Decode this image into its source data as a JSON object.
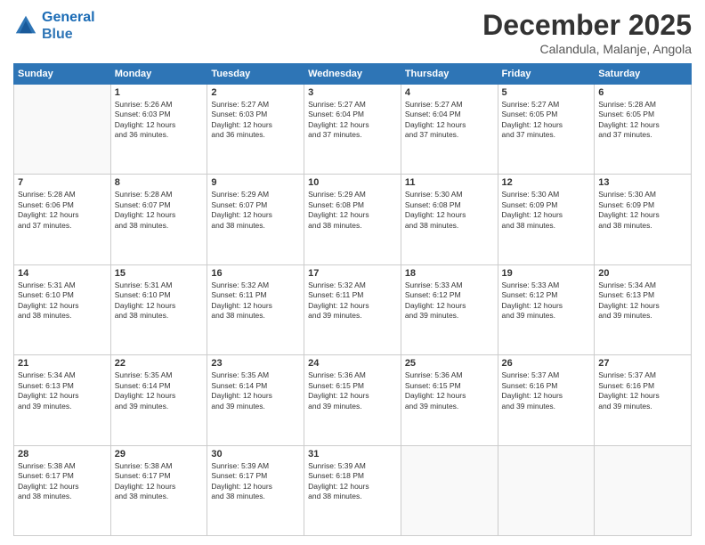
{
  "header": {
    "logo_line1": "General",
    "logo_line2": "Blue",
    "title": "December 2025",
    "subtitle": "Calandula, Malanje, Angola"
  },
  "calendar": {
    "days_of_week": [
      "Sunday",
      "Monday",
      "Tuesday",
      "Wednesday",
      "Thursday",
      "Friday",
      "Saturday"
    ],
    "weeks": [
      [
        {
          "day": "",
          "info": ""
        },
        {
          "day": "1",
          "info": "Sunrise: 5:26 AM\nSunset: 6:03 PM\nDaylight: 12 hours\nand 36 minutes."
        },
        {
          "day": "2",
          "info": "Sunrise: 5:27 AM\nSunset: 6:03 PM\nDaylight: 12 hours\nand 36 minutes."
        },
        {
          "day": "3",
          "info": "Sunrise: 5:27 AM\nSunset: 6:04 PM\nDaylight: 12 hours\nand 37 minutes."
        },
        {
          "day": "4",
          "info": "Sunrise: 5:27 AM\nSunset: 6:04 PM\nDaylight: 12 hours\nand 37 minutes."
        },
        {
          "day": "5",
          "info": "Sunrise: 5:27 AM\nSunset: 6:05 PM\nDaylight: 12 hours\nand 37 minutes."
        },
        {
          "day": "6",
          "info": "Sunrise: 5:28 AM\nSunset: 6:05 PM\nDaylight: 12 hours\nand 37 minutes."
        }
      ],
      [
        {
          "day": "7",
          "info": "Sunrise: 5:28 AM\nSunset: 6:06 PM\nDaylight: 12 hours\nand 37 minutes."
        },
        {
          "day": "8",
          "info": "Sunrise: 5:28 AM\nSunset: 6:07 PM\nDaylight: 12 hours\nand 38 minutes."
        },
        {
          "day": "9",
          "info": "Sunrise: 5:29 AM\nSunset: 6:07 PM\nDaylight: 12 hours\nand 38 minutes."
        },
        {
          "day": "10",
          "info": "Sunrise: 5:29 AM\nSunset: 6:08 PM\nDaylight: 12 hours\nand 38 minutes."
        },
        {
          "day": "11",
          "info": "Sunrise: 5:30 AM\nSunset: 6:08 PM\nDaylight: 12 hours\nand 38 minutes."
        },
        {
          "day": "12",
          "info": "Sunrise: 5:30 AM\nSunset: 6:09 PM\nDaylight: 12 hours\nand 38 minutes."
        },
        {
          "day": "13",
          "info": "Sunrise: 5:30 AM\nSunset: 6:09 PM\nDaylight: 12 hours\nand 38 minutes."
        }
      ],
      [
        {
          "day": "14",
          "info": "Sunrise: 5:31 AM\nSunset: 6:10 PM\nDaylight: 12 hours\nand 38 minutes."
        },
        {
          "day": "15",
          "info": "Sunrise: 5:31 AM\nSunset: 6:10 PM\nDaylight: 12 hours\nand 38 minutes."
        },
        {
          "day": "16",
          "info": "Sunrise: 5:32 AM\nSunset: 6:11 PM\nDaylight: 12 hours\nand 38 minutes."
        },
        {
          "day": "17",
          "info": "Sunrise: 5:32 AM\nSunset: 6:11 PM\nDaylight: 12 hours\nand 39 minutes."
        },
        {
          "day": "18",
          "info": "Sunrise: 5:33 AM\nSunset: 6:12 PM\nDaylight: 12 hours\nand 39 minutes."
        },
        {
          "day": "19",
          "info": "Sunrise: 5:33 AM\nSunset: 6:12 PM\nDaylight: 12 hours\nand 39 minutes."
        },
        {
          "day": "20",
          "info": "Sunrise: 5:34 AM\nSunset: 6:13 PM\nDaylight: 12 hours\nand 39 minutes."
        }
      ],
      [
        {
          "day": "21",
          "info": "Sunrise: 5:34 AM\nSunset: 6:13 PM\nDaylight: 12 hours\nand 39 minutes."
        },
        {
          "day": "22",
          "info": "Sunrise: 5:35 AM\nSunset: 6:14 PM\nDaylight: 12 hours\nand 39 minutes."
        },
        {
          "day": "23",
          "info": "Sunrise: 5:35 AM\nSunset: 6:14 PM\nDaylight: 12 hours\nand 39 minutes."
        },
        {
          "day": "24",
          "info": "Sunrise: 5:36 AM\nSunset: 6:15 PM\nDaylight: 12 hours\nand 39 minutes."
        },
        {
          "day": "25",
          "info": "Sunrise: 5:36 AM\nSunset: 6:15 PM\nDaylight: 12 hours\nand 39 minutes."
        },
        {
          "day": "26",
          "info": "Sunrise: 5:37 AM\nSunset: 6:16 PM\nDaylight: 12 hours\nand 39 minutes."
        },
        {
          "day": "27",
          "info": "Sunrise: 5:37 AM\nSunset: 6:16 PM\nDaylight: 12 hours\nand 39 minutes."
        }
      ],
      [
        {
          "day": "28",
          "info": "Sunrise: 5:38 AM\nSunset: 6:17 PM\nDaylight: 12 hours\nand 38 minutes."
        },
        {
          "day": "29",
          "info": "Sunrise: 5:38 AM\nSunset: 6:17 PM\nDaylight: 12 hours\nand 38 minutes."
        },
        {
          "day": "30",
          "info": "Sunrise: 5:39 AM\nSunset: 6:17 PM\nDaylight: 12 hours\nand 38 minutes."
        },
        {
          "day": "31",
          "info": "Sunrise: 5:39 AM\nSunset: 6:18 PM\nDaylight: 12 hours\nand 38 minutes."
        },
        {
          "day": "",
          "info": ""
        },
        {
          "day": "",
          "info": ""
        },
        {
          "day": "",
          "info": ""
        }
      ]
    ]
  }
}
